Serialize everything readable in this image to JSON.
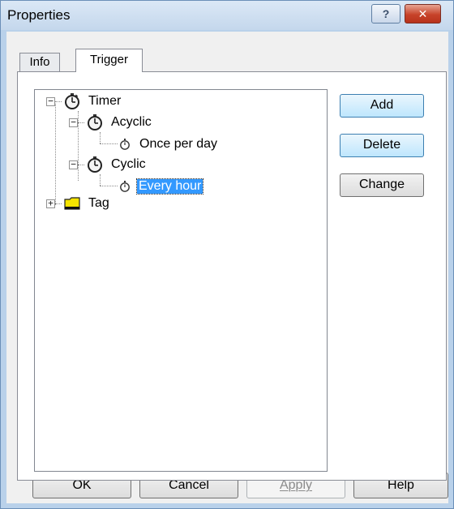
{
  "window": {
    "title": "Properties",
    "help_label": "?",
    "close_label": "✕"
  },
  "tabs": [
    {
      "label": "Info",
      "active": false
    },
    {
      "label": "Trigger",
      "active": true
    }
  ],
  "tree": {
    "timer": {
      "label": "Timer",
      "icon": "stopwatch-icon",
      "expanded": true
    },
    "acyclic": {
      "label": "Acyclic",
      "icon": "stopwatch-icon",
      "expanded": true
    },
    "once_per_day": {
      "label": "Once per day",
      "icon": "stopwatch-small-icon"
    },
    "cyclic": {
      "label": "Cyclic",
      "icon": "stopwatch-icon",
      "expanded": true
    },
    "every_hour": {
      "label": "Every hour",
      "icon": "stopwatch-small-icon",
      "selected": true
    },
    "tag": {
      "label": "Tag",
      "icon": "folder-tag-icon",
      "expanded": false
    }
  },
  "side_buttons": {
    "add": "Add",
    "delete": "Delete",
    "change": "Change"
  },
  "bottom_buttons": {
    "ok": "OK",
    "cancel": "Cancel",
    "apply": "Apply",
    "help": "Help"
  },
  "colors": {
    "selection": "#3399ff",
    "window_frame": "#b9d1ea",
    "close_button": "#c7432a"
  }
}
